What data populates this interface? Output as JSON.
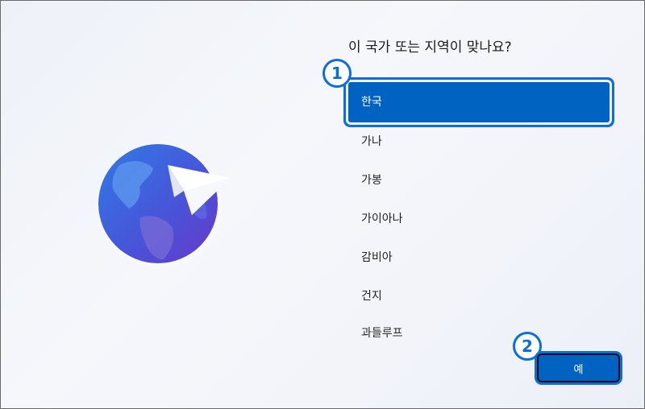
{
  "dialog": {
    "title": "이 국가 또는 지역이 맞나요?"
  },
  "countries": [
    {
      "label": "한국",
      "selected": true
    },
    {
      "label": "가나",
      "selected": false
    },
    {
      "label": "가봉",
      "selected": false
    },
    {
      "label": "가이아나",
      "selected": false
    },
    {
      "label": "감비아",
      "selected": false
    },
    {
      "label": "건지",
      "selected": false
    },
    {
      "label": "과들루프",
      "selected": false
    }
  ],
  "callouts": {
    "step1": "1",
    "step2": "2"
  },
  "footer": {
    "yes_label": "예"
  },
  "colors": {
    "accent": "#0063c1",
    "highlight_border": "#0a6ee0",
    "background": "#f2f4fa"
  },
  "icons": {
    "illustration": "globe-with-paper-plane-icon"
  }
}
